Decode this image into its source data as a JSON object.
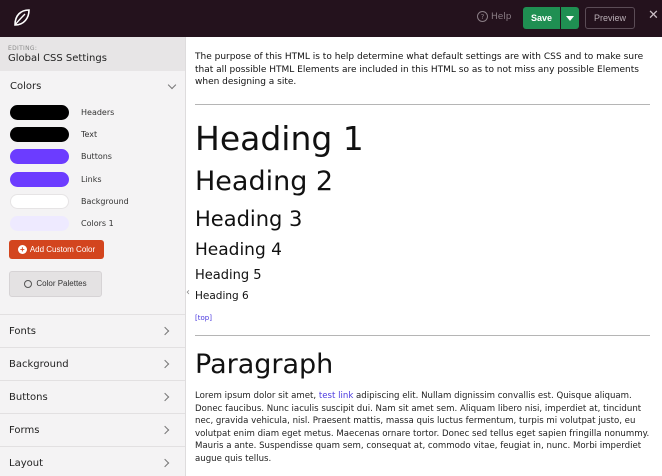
{
  "topbar": {
    "help_label": "Help",
    "help_glyph": "?",
    "save_label": "Save",
    "preview_label": "Preview",
    "close_glyph": "✕"
  },
  "sidebar": {
    "editing_label": "EDITING:",
    "editing_title": "Global CSS Settings",
    "colors_title": "Colors",
    "colors": [
      {
        "label": "Headers",
        "color": "#000000"
      },
      {
        "label": "Text",
        "color": "#000000"
      },
      {
        "label": "Buttons",
        "color": "#6c3cff"
      },
      {
        "label": "Links",
        "color": "#6c3cff"
      },
      {
        "label": "Background",
        "color": "#ffffff"
      },
      {
        "label": "Colors 1",
        "color": "#eeeaff"
      }
    ],
    "add_color_label": "Add Custom Color",
    "palettes_label": "Color Palettes",
    "sections": [
      "Fonts",
      "Background",
      "Buttons",
      "Forms",
      "Layout"
    ]
  },
  "content": {
    "intro": "The purpose of this HTML is to help determine what default settings are with CSS and to make sure that all possible HTML Elements are included in this HTML so as to not miss any possible Elements when designing a site.",
    "headings": [
      "Heading 1",
      "Heading 2",
      "Heading 3",
      "Heading 4",
      "Heading 5",
      "Heading 6"
    ],
    "top_link": "[top]",
    "paragraph_title": "Paragraph",
    "paragraph_before": "Lorem ipsum dolor sit amet, ",
    "paragraph_link": "test link",
    "paragraph_after": " adipiscing elit. Nullam dignissim convallis est. Quisque aliquam. Donec faucibus. Nunc iaculis suscipit dui. Nam sit amet sem. Aliquam libero nisi, imperdiet at, tincidunt nec, gravida vehicula, nisl. Praesent mattis, massa quis luctus fermentum, turpis mi volutpat justo, eu volutpat enim diam eget metus. Maecenas ornare tortor. Donec sed tellus eget sapien fringilla nonummy. Mauris a ante. Suspendisse quam sem, consequat at, commodo vitae, feugiat in, nunc. Morbi imperdiet augue quis tellus."
  },
  "colors": {
    "topbar_bg": "#24121d",
    "save_green": "#1f8f52",
    "accent_orange": "#d3451e",
    "link_purple": "#4b3adf"
  }
}
